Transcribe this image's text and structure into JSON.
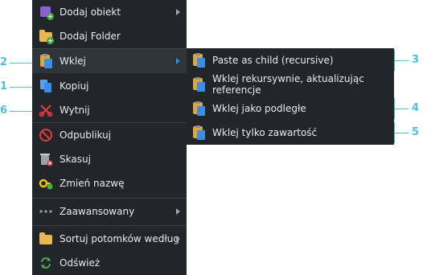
{
  "menu": {
    "items": [
      {
        "label": "Dodaj obiekt",
        "icon": "add-object-icon",
        "has_submenu": true
      },
      {
        "label": "Dodaj Folder",
        "icon": "add-folder-icon",
        "has_submenu": false
      },
      {
        "label": "Wklej",
        "icon": "paste-icon",
        "has_submenu": true
      },
      {
        "label": "Kopiuj",
        "icon": "copy-icon",
        "has_submenu": false
      },
      {
        "label": "Wytnij",
        "icon": "scissors-icon",
        "has_submenu": false
      },
      {
        "label": "Odpublikuj",
        "icon": "unpublish-icon",
        "has_submenu": false
      },
      {
        "label": "Skasuj",
        "icon": "delete-icon",
        "has_submenu": false
      },
      {
        "label": "Zmień nazwę",
        "icon": "rename-icon",
        "has_submenu": false
      },
      {
        "label": "Zaawansowany",
        "icon": "more-icon",
        "has_submenu": true
      },
      {
        "label": "Sortuj potomków według",
        "icon": "sort-folder-icon",
        "has_submenu": true
      },
      {
        "label": "Odśwież",
        "icon": "refresh-icon",
        "has_submenu": false
      }
    ]
  },
  "submenu": {
    "items": [
      {
        "label": "Paste as child (recursive)"
      },
      {
        "label": "Wklej rekursywnie, aktualizując referencje"
      },
      {
        "label": "Wklej jako podległe"
      },
      {
        "label": "Wklej tylko zawartość"
      }
    ]
  },
  "annotations": {
    "left": [
      "2",
      "1",
      "6"
    ],
    "right": [
      "3",
      "4",
      "5"
    ]
  },
  "colors": {
    "menu_bg": "#22262b",
    "accent": "#4cc0df",
    "active_row": "#2f3439"
  }
}
